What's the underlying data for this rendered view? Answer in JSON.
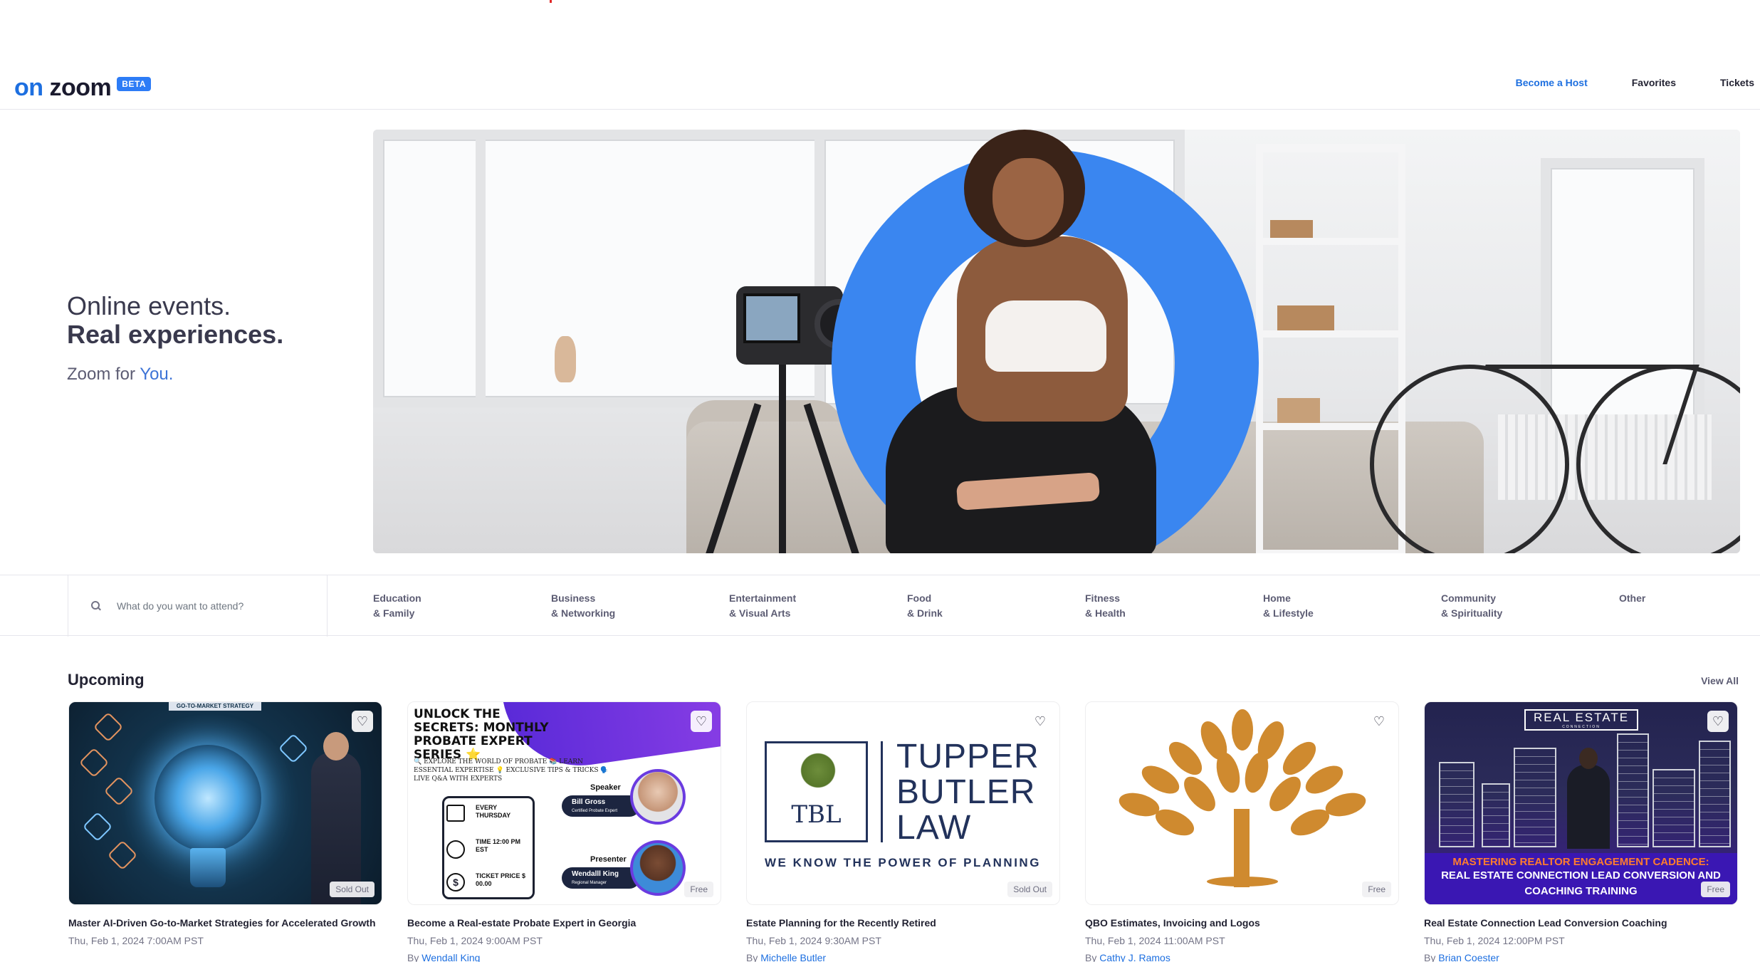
{
  "header": {
    "logo_on": "on",
    "logo_zoom": "zoom",
    "logo_badge": "BETA",
    "nav": {
      "become_host": "Become a Host",
      "favorites": "Favorites",
      "tickets": "Tickets"
    }
  },
  "hero": {
    "line1": "Online events.",
    "line2": "Real experiences.",
    "line3_prefix": "Zoom for ",
    "line3_highlight": "You."
  },
  "search": {
    "placeholder": "What do you want to attend?"
  },
  "categories": [
    {
      "line1": "Education",
      "line2": "& Family"
    },
    {
      "line1": "Business",
      "line2": "& Networking"
    },
    {
      "line1": "Entertainment",
      "line2": "& Visual Arts"
    },
    {
      "line1": "Food",
      "line2": "& Drink"
    },
    {
      "line1": "Fitness",
      "line2": "& Health"
    },
    {
      "line1": "Home",
      "line2": "& Lifestyle"
    },
    {
      "line1": "Community",
      "line2": "& Spirituality"
    },
    {
      "line1": "Other",
      "line2": ""
    }
  ],
  "upcoming": {
    "title": "Upcoming",
    "view_all": "View All",
    "events": [
      {
        "title": "Master AI-Driven Go-to-Market Strategies for Accelerated Growth",
        "date": "Thu, Feb 1, 2024 7:00AM PST",
        "by_prefix": "",
        "host": "",
        "badge": "Sold Out",
        "art_text": "GO-TO-MARKET STRATEGY"
      },
      {
        "title": "Become a Real-estate Probate Expert in Georgia",
        "date": "Thu, Feb 1, 2024 9:00AM PST",
        "by_prefix": "By ",
        "host": "Wendall King",
        "badge": "Free",
        "art": {
          "headline": "UNLOCK THE SECRETS: MONTHLY PROBATE EXPERT SERIES ⭐",
          "tagline": "🔍 EXPLORE THE WORLD OF PROBATE 📚 LEARN ESSENTIAL EXPERTISE 💡 EXCLUSIVE TIPS & TRICKS 🗣️ LIVE Q&A WITH EXPERTS",
          "when": "EVERY THURSDAY",
          "time": "TIME 12:00 PM EST",
          "price": "TICKET PRICE $ 00.00",
          "speaker_label": "Speaker",
          "speaker_name": "Bill Gross",
          "speaker_role": "Certified Probate Expert",
          "presenter_label": "Presenter",
          "presenter_name": "Wendalll King",
          "presenter_role": "Regional Manager"
        }
      },
      {
        "title": "Estate Planning for the Recently Retired",
        "date": "Thu, Feb 1, 2024 9:30AM PST",
        "by_prefix": "By ",
        "host": "Michelle Butler",
        "badge": "Sold Out",
        "art": {
          "monogram": "TBL",
          "firm_line1": "TUPPER",
          "firm_line2": "BUTLER",
          "firm_line3": "LAW",
          "tagline": "WE KNOW THE POWER OF PLANNING"
        }
      },
      {
        "title": "QBO Estimates, Invoicing and Logos",
        "date": "Thu, Feb 1, 2024 11:00AM PST",
        "by_prefix": "By ",
        "host": "Cathy J. Ramos",
        "badge": "Free"
      },
      {
        "title": "Real Estate Connection Lead Conversion Coaching",
        "date": "Thu, Feb 1, 2024 12:00PM PST",
        "by_prefix": "By ",
        "host": "Brian Coester",
        "badge": "Free",
        "art": {
          "logo_main": "REAL ESTATE",
          "logo_sub": "CONNECTION",
          "caption1": "MASTERING REALTOR ENGAGEMENT CADENCE:",
          "caption2": "REAL ESTATE CONNECTION LEAD CONVERSION AND",
          "caption3": "COACHING TRAINING"
        }
      }
    ]
  },
  "colors": {
    "accent": "#1d6fe0",
    "beta_badge": "#2d7cf6",
    "hero_ring": "#3a86f0",
    "text_primary": "#232333",
    "text_muted": "#747487"
  },
  "icons": {
    "search": "search-icon",
    "heart": "heart-icon"
  }
}
